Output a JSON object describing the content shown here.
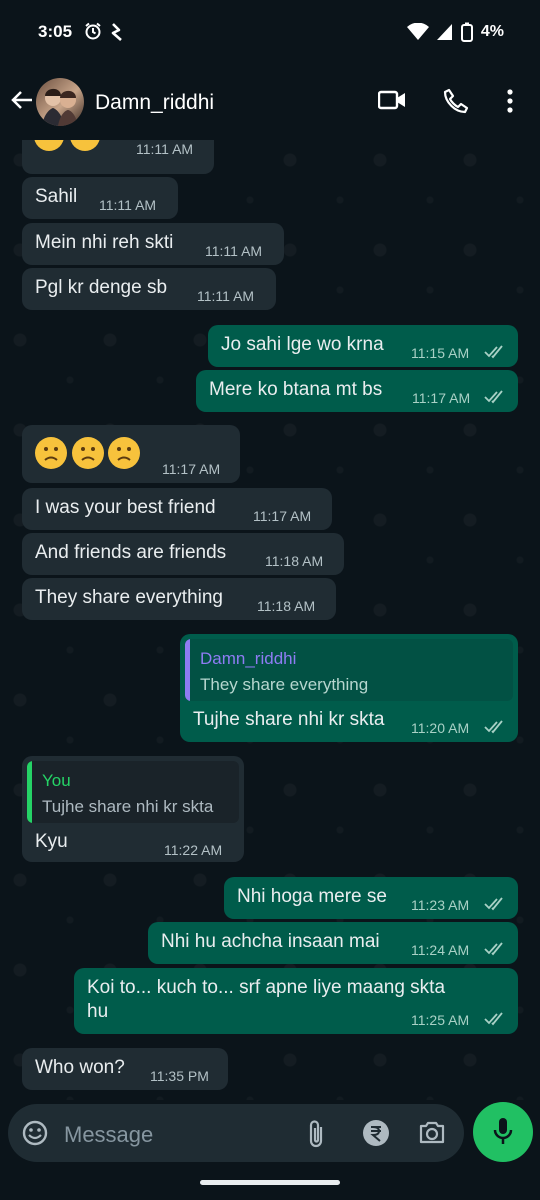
{
  "status": {
    "time": "3:05",
    "battery": "4%"
  },
  "header": {
    "contact_name": "Damn_riddhi"
  },
  "messages": [
    {
      "dir": "in",
      "text": "",
      "time": "11:11 AM",
      "emoji": true
    },
    {
      "dir": "in",
      "text": "Sahil",
      "time": "11:11 AM"
    },
    {
      "dir": "in",
      "text": "Mein nhi reh skti",
      "time": "11:11 AM"
    },
    {
      "dir": "in",
      "text": "Pgl kr denge sb",
      "time": "11:11 AM"
    },
    {
      "dir": "out",
      "text": "Jo sahi lge wo krna",
      "time": "11:15 AM"
    },
    {
      "dir": "out",
      "text": "Mere ko btana mt bs",
      "time": "11:17 AM"
    },
    {
      "dir": "in",
      "text": "",
      "time": "11:17 AM",
      "emoji": true
    },
    {
      "dir": "in",
      "text": "I was your best friend",
      "time": "11:17 AM"
    },
    {
      "dir": "in",
      "text": "And friends are friends",
      "time": "11:18 AM"
    },
    {
      "dir": "in",
      "text": "They share everything",
      "time": "11:18 AM"
    },
    {
      "dir": "out",
      "text": "Tujhe share nhi kr skta",
      "time": "11:20 AM",
      "quote": {
        "name": "Damn_riddhi",
        "text": "They share everything"
      }
    },
    {
      "dir": "in",
      "text": "Kyu",
      "time": "11:22 AM",
      "quote": {
        "name": "You",
        "text": "Tujhe share nhi kr skta"
      }
    },
    {
      "dir": "out",
      "text": "Nhi hoga mere se",
      "time": "11:23 AM"
    },
    {
      "dir": "out",
      "text": "Nhi hu achcha insaan mai",
      "time": "11:24 AM"
    },
    {
      "dir": "out",
      "text": "Koi to... kuch to... srf apne liye maang skta",
      "text2": "hu",
      "time": "11:25 AM"
    },
    {
      "dir": "in",
      "text": "Who won?",
      "time": "11:35 PM"
    }
  ],
  "composer": {
    "placeholder": "Message"
  },
  "colors": {
    "accent": "#21c063",
    "outgoing": "#005c4b",
    "incoming": "#202c33",
    "quote_in": "#8e7cf3",
    "quote_out": "#25d366",
    "tick": "#a9d1c6"
  }
}
